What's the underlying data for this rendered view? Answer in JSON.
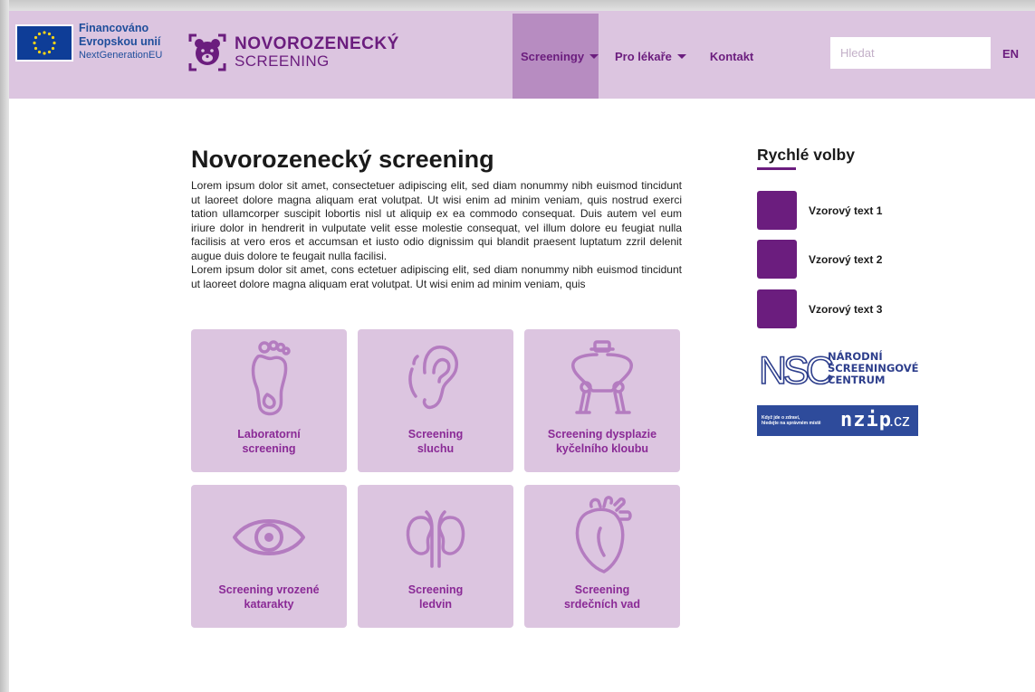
{
  "header": {
    "eu": {
      "line1": "Financováno",
      "line2": "Evropskou unií",
      "line3": "NextGenerationEU"
    },
    "logo": {
      "line1": "NOVOROZENECKÝ",
      "line2": "SCREENING"
    },
    "nav": [
      {
        "label": "Screeningy",
        "has_dropdown": true,
        "active": true
      },
      {
        "label": "Pro lékaře",
        "has_dropdown": true,
        "active": false
      },
      {
        "label": "Kontakt",
        "has_dropdown": false,
        "active": false
      }
    ],
    "search": {
      "placeholder": "Hledat",
      "value": ""
    },
    "lang": "EN"
  },
  "main": {
    "title": "Novorozenecký screening",
    "paragraph1": "Lorem ipsum dolor sit amet, consectetuer adipiscing elit, sed diam nonummy nibh euismod tincidunt ut laoreet dolore magna aliquam erat volutpat. Ut wisi enim ad minim veniam, quis nostrud exerci tation ullamcorper suscipit lobortis nisl ut aliquip ex ea commodo consequat. Duis autem vel eum iriure dolor in hendrerit in vulputate velit esse molestie consequat, vel illum dolore eu feugiat nulla facilisis at vero eros et accumsan et iusto odio dignissim qui blandit praesent luptatum zzril delenit augue duis dolore te feugait nulla facilisi.",
    "paragraph2": "Lorem ipsum dolor sit amet, cons ectetuer adipiscing elit, sed diam nonummy nibh euismod tincidunt ut laoreet dolore magna aliquam erat volutpat. Ut wisi enim ad minim veniam, quis",
    "tiles": [
      {
        "line1": "Laboratorní",
        "line2": "screening",
        "icon": "foot-icon"
      },
      {
        "line1": "Screening",
        "line2": "sluchu",
        "icon": "ear-icon"
      },
      {
        "line1": "Screening dysplazie",
        "line2": "kyčelního kloubu",
        "icon": "hip-icon"
      },
      {
        "line1": "Screening vrozené",
        "line2": "katarakty",
        "icon": "eye-icon"
      },
      {
        "line1": "Screening",
        "line2": "ledvin",
        "icon": "kidneys-icon"
      },
      {
        "line1": "Screening",
        "line2": "srdečních vad",
        "icon": "heart-icon"
      }
    ]
  },
  "sidebar": {
    "title": "Rychlé volby",
    "items": [
      {
        "label": "Vzorový text 1"
      },
      {
        "label": "Vzorový text 2"
      },
      {
        "label": "Vzorový text 3"
      }
    ],
    "nsc": {
      "line1": "NÁRODNÍ",
      "line2": "SCREENINGOVÉ",
      "line3": "CENTRUM",
      "mark": "NSC"
    },
    "nzip": {
      "small1": "Když jde o zdraví,",
      "small2": "hledejte na správném místě",
      "brand": "nzip",
      "tld": ".cz"
    }
  },
  "colors": {
    "header_bg": "#dcc5e0",
    "nav_active_bg": "#b78cc1",
    "brand_purple": "#6b1d7e",
    "tile_bg": "#dcc5e0",
    "tile_icon": "#b47cc0",
    "tile_label": "#8a2a96",
    "eu_blue": "#0e3d97",
    "nzip_blue": "#2e4b9b",
    "nsc_blue": "#2d3e8c"
  }
}
